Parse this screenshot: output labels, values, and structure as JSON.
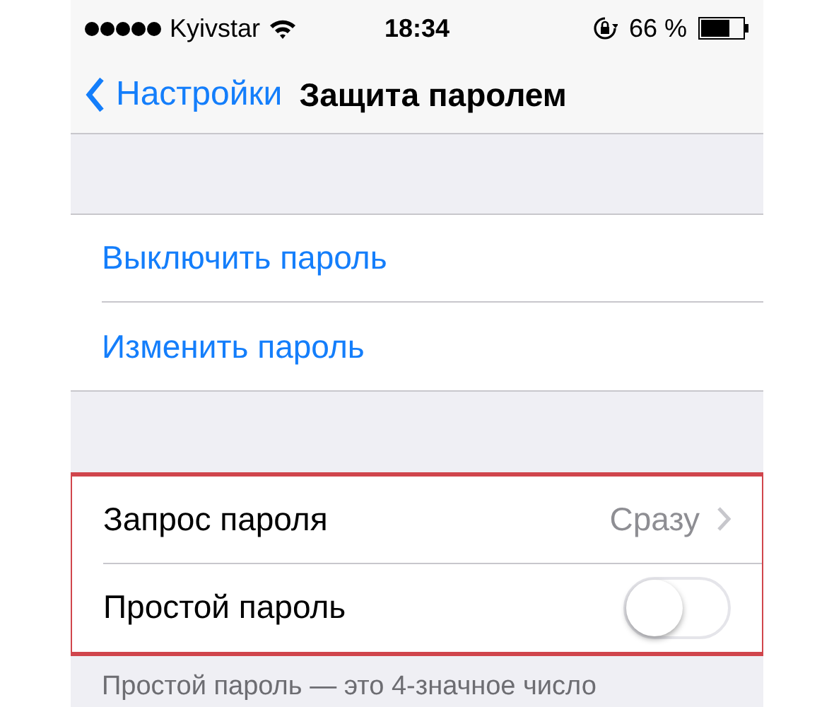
{
  "status_bar": {
    "carrier": "Kyivstar",
    "time": "18:34",
    "battery": "66 %"
  },
  "nav": {
    "back": "Настройки",
    "title": "Защита паролем"
  },
  "groups": [
    {
      "highlighted": false,
      "rows": [
        {
          "kind": "action",
          "label": "Выключить пароль"
        },
        {
          "kind": "action",
          "label": "Изменить пароль"
        }
      ]
    },
    {
      "highlighted": true,
      "rows": [
        {
          "kind": "detail",
          "label": "Запрос пароля",
          "value": "Сразу"
        },
        {
          "kind": "toggle",
          "label": "Простой пароль",
          "on": false
        }
      ]
    }
  ],
  "footer": "Простой пароль — это 4-значное число"
}
